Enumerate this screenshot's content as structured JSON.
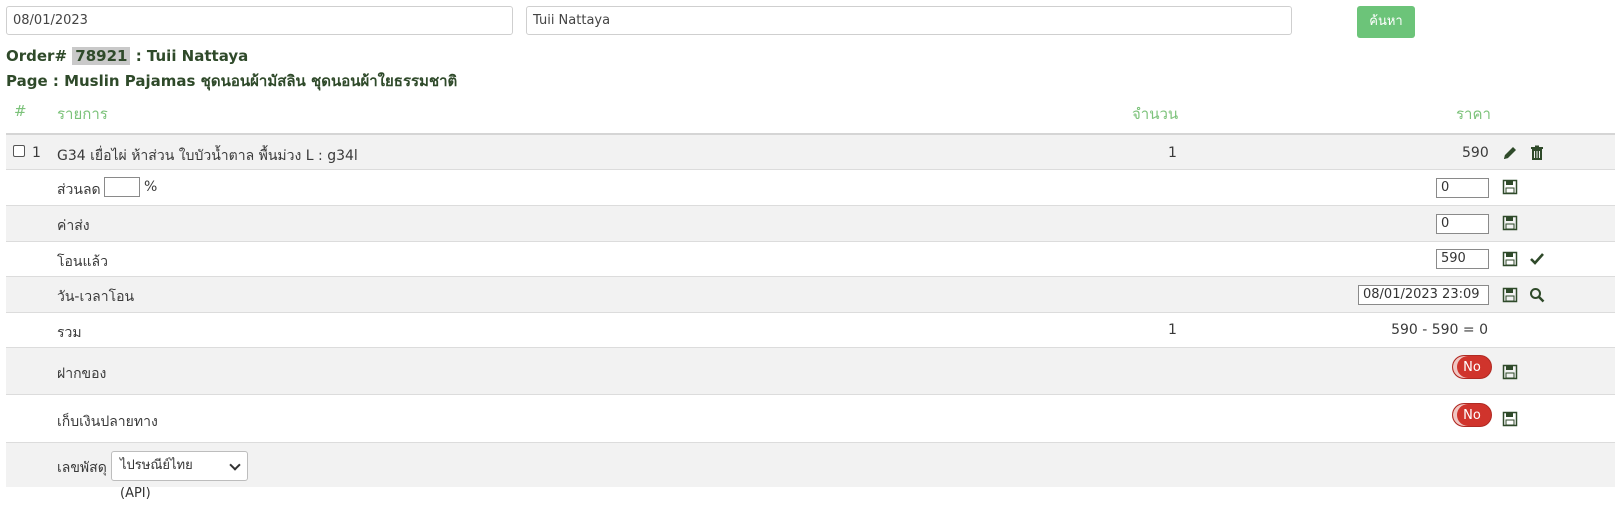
{
  "search": {
    "date_value": "08/01/2023",
    "name_value": "Tuii Nattaya",
    "button_label": "ค้นหา"
  },
  "order": {
    "prefix": "Order#",
    "number": "78921",
    "sep_customer": ": Tuii Nattaya",
    "page_line": "Page : Muslin Pajamas ชุดนอนผ้ามัสลิน ชุดนอนผ้าใยธรรมชาติ"
  },
  "table": {
    "headers": {
      "num": "#",
      "item": "รายการ",
      "qty": "จำนวน",
      "price": "ราคา"
    },
    "item_row": {
      "index": "1",
      "name": "G34 เยื่อไผ่ ห้าส่วน ใบบัวน้ำตาล พื้นม่วง L : g34l",
      "qty": "1",
      "price": "590"
    },
    "discount": {
      "label": "ส่วนลด",
      "percent_value": "",
      "percent_sign": "%",
      "value": "0"
    },
    "shipping": {
      "label": "ค่าส่ง",
      "value": "0"
    },
    "transferred": {
      "label": "โอนแล้ว",
      "value": "590"
    },
    "transfer_datetime": {
      "label": "วัน-เวลาโอน",
      "value": "08/01/2023 23:09"
    },
    "total": {
      "label": "รวม",
      "qty": "1",
      "summary": "590 - 590 = 0"
    },
    "deposit": {
      "label": "ฝากของ",
      "toggle": "No"
    },
    "cod": {
      "label": "เก็บเงินปลายทาง",
      "toggle": "No"
    },
    "tracking": {
      "label": "เลขพัสดุ",
      "selected": "ไปรษณีย์ไทย (API)"
    }
  }
}
